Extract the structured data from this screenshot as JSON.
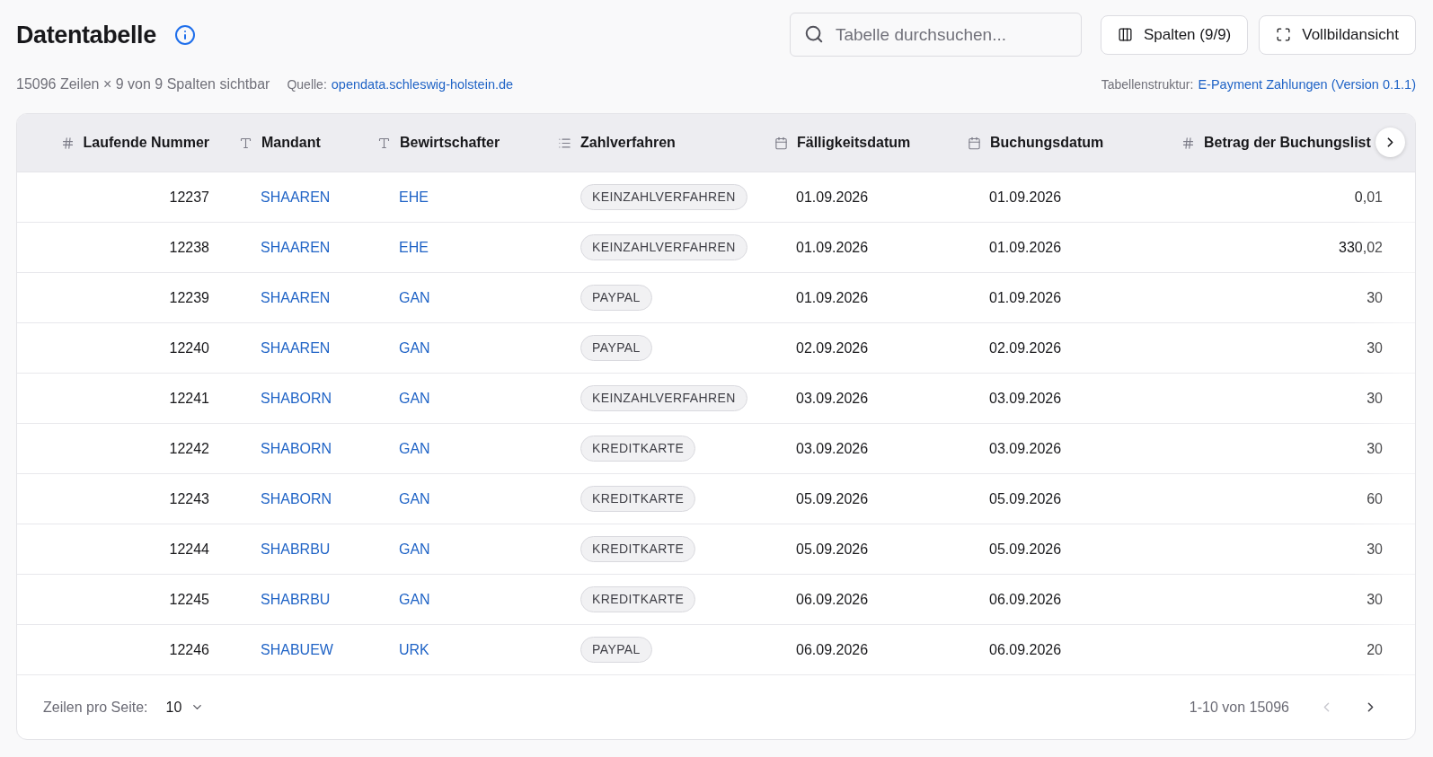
{
  "header": {
    "title": "Datentabelle",
    "summary": "15096 Zeilen × 9 von 9 Spalten sichtbar",
    "source_label": "Quelle:",
    "source_link": "opendata.schleswig-holstein.de",
    "structure_label": "Tabellenstruktur:",
    "structure_link": "E-Payment Zahlungen (Version 0.1.1)"
  },
  "search": {
    "placeholder": "Tabelle durchsuchen..."
  },
  "toolbar": [
    {
      "kind": "columns",
      "label": "Spalten (9/9)"
    },
    {
      "kind": "fullscreen",
      "label": "Vollbildansicht"
    }
  ],
  "table": {
    "columns": [
      {
        "label": "Laufende Nummer",
        "kind": "number"
      },
      {
        "label": "Mandant",
        "kind": "text"
      },
      {
        "label": "Bewirtschafter",
        "kind": "text"
      },
      {
        "label": "Zahlverfahren",
        "kind": "enum"
      },
      {
        "label": "Fälligkeitsdatum",
        "kind": "date"
      },
      {
        "label": "Buchungsdatum",
        "kind": "date"
      },
      {
        "label": "Betrag der Buchungslist",
        "kind": "number"
      }
    ],
    "rows": [
      {
        "cells": [
          "12237",
          "SHAAREN",
          "EHE",
          "KEINZAHLVERFAHREN",
          "01.09.2026",
          "01.09.2026",
          "0,01"
        ]
      },
      {
        "cells": [
          "12238",
          "SHAAREN",
          "EHE",
          "KEINZAHLVERFAHREN",
          "01.09.2026",
          "01.09.2026",
          "330,02"
        ]
      },
      {
        "cells": [
          "12239",
          "SHAAREN",
          "GAN",
          "PAYPAL",
          "01.09.2026",
          "01.09.2026",
          "30"
        ]
      },
      {
        "cells": [
          "12240",
          "SHAAREN",
          "GAN",
          "PAYPAL",
          "02.09.2026",
          "02.09.2026",
          "30"
        ]
      },
      {
        "cells": [
          "12241",
          "SHABORN",
          "GAN",
          "KEINZAHLVERFAHREN",
          "03.09.2026",
          "03.09.2026",
          "30"
        ]
      },
      {
        "cells": [
          "12242",
          "SHABORN",
          "GAN",
          "KREDITKARTE",
          "03.09.2026",
          "03.09.2026",
          "30"
        ]
      },
      {
        "cells": [
          "12243",
          "SHABORN",
          "GAN",
          "KREDITKARTE",
          "05.09.2026",
          "05.09.2026",
          "60"
        ]
      },
      {
        "cells": [
          "12244",
          "SHABRBU",
          "GAN",
          "KREDITKARTE",
          "05.09.2026",
          "05.09.2026",
          "30"
        ]
      },
      {
        "cells": [
          "12245",
          "SHABRBU",
          "GAN",
          "KREDITKARTE",
          "06.09.2026",
          "06.09.2026",
          "30"
        ]
      },
      {
        "cells": [
          "12246",
          "SHABUEW",
          "URK",
          "PAYPAL",
          "06.09.2026",
          "06.09.2026",
          "20"
        ]
      }
    ]
  },
  "pagination": {
    "rows_per_page_label": "Zeilen pro Seite:",
    "rows_per_page": "10",
    "range": "1-10 von 15096",
    "previous": {
      "disabled": true
    },
    "next": {
      "disabled": false
    }
  }
}
